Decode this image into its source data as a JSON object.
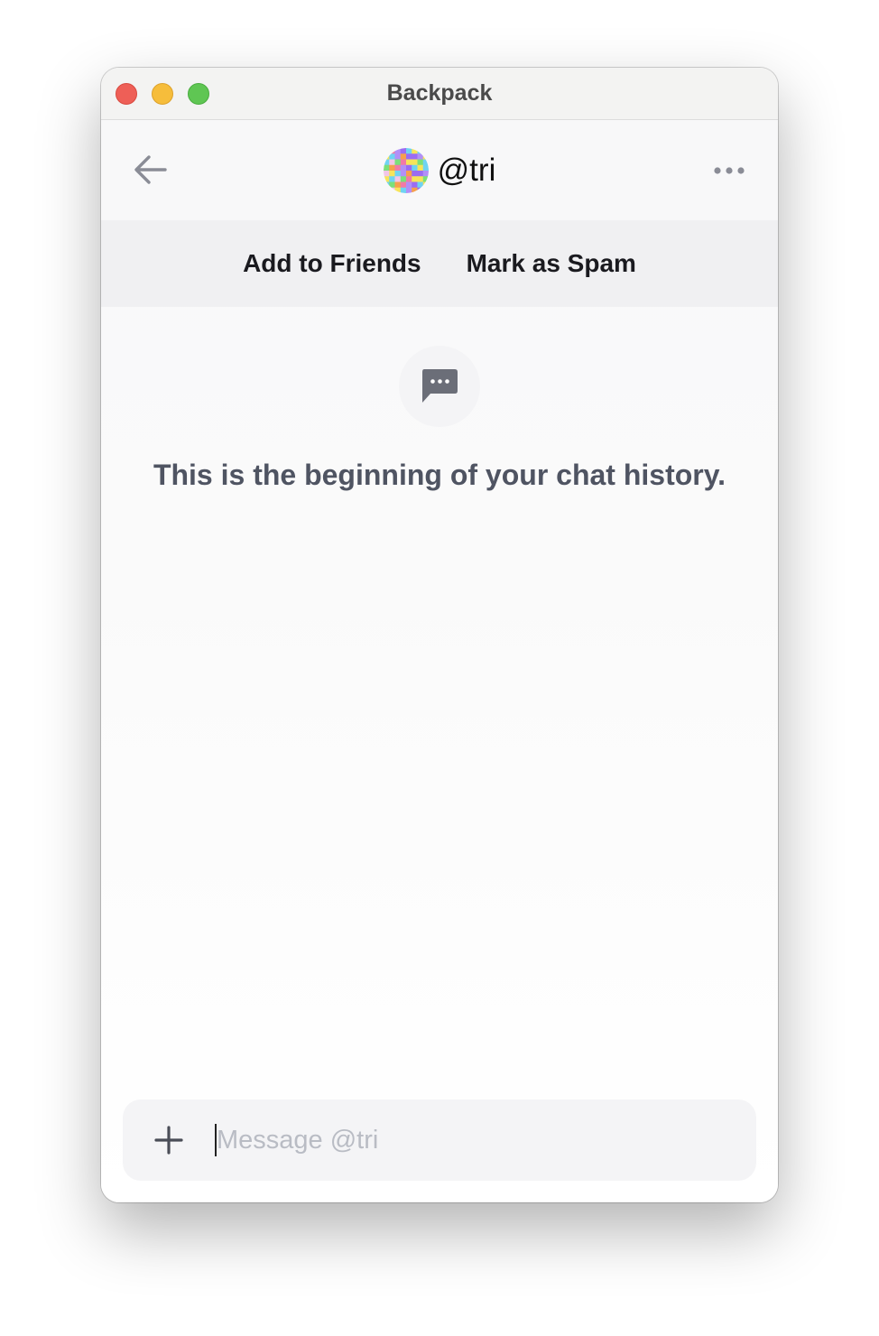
{
  "window": {
    "title": "Backpack"
  },
  "header": {
    "back_icon": "arrow-left-icon",
    "username": "@tri",
    "more_icon": "more-horizontal-icon"
  },
  "actions": {
    "add_friends_label": "Add to Friends",
    "mark_spam_label": "Mark as Spam"
  },
  "empty_state": {
    "icon": "chat-bubble-icon",
    "message": "This is the beginning of your chat history."
  },
  "composer": {
    "add_icon": "plus-icon",
    "placeholder": "Message @tri",
    "value": ""
  },
  "colors": {
    "traffic_red": "#ee5f57",
    "traffic_yellow": "#f6bd3b",
    "traffic_green": "#5fc653",
    "text_muted": "#4f5462",
    "icon_gray": "#6b6e78"
  }
}
